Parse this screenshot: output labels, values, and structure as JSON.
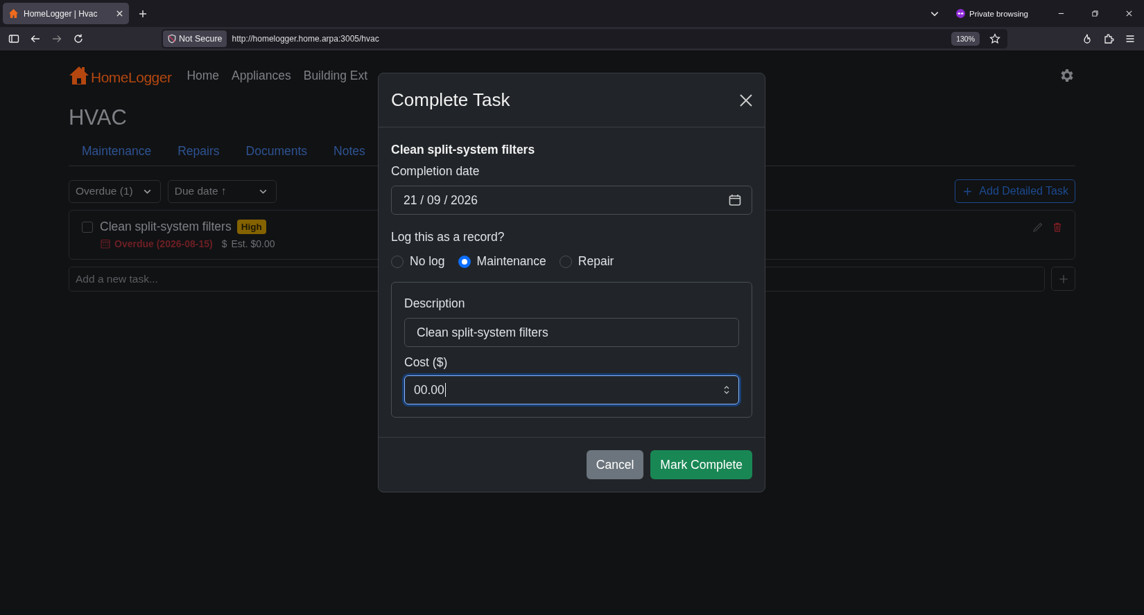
{
  "browser": {
    "tab_title": "HomeLogger | Hvac",
    "security": "Not Secure",
    "url": "http://homelogger.home.arpa:3005/hvac",
    "zoom": "130%",
    "private_label": "Private browsing"
  },
  "app": {
    "brand": "HomeLogger",
    "nav": [
      "Home",
      "Appliances",
      "Building Ext"
    ],
    "page_title": "HVAC",
    "tabs": [
      "Maintenance",
      "Repairs",
      "Documents",
      "Notes"
    ],
    "filters": [
      {
        "value": "Overdue (1)"
      },
      {
        "value": "Due date ↑"
      }
    ],
    "add_button": "Add Detailed Task",
    "tasks": [
      {
        "title": "Clean split-system filters",
        "checked": false,
        "priority": "High",
        "due": "Overdue (2026-08-15)",
        "currency_symbol": "$",
        "estimate": "Est. $0.00"
      }
    ],
    "new_task": {
      "placeholder": "Add a new task..."
    }
  },
  "modal": {
    "title": "Complete Task",
    "task_name": "Clean split-system filters",
    "date_label": "Completion date",
    "date_value": "21 / 09 / 2026",
    "record_label": "Log this as a record?",
    "record_options": [
      {
        "label": "No log",
        "selected": false
      },
      {
        "label": "Maintenance",
        "selected": true
      },
      {
        "label": "Repair",
        "selected": false
      }
    ],
    "description_label": "Description",
    "description_value": "Clean split-system filters",
    "cost_label": "Cost ($)",
    "cost_value": "00.00",
    "buttons": [
      {
        "kind": "cancel",
        "label": "Cancel"
      },
      {
        "kind": "confirm",
        "label": "Mark Complete"
      }
    ]
  }
}
